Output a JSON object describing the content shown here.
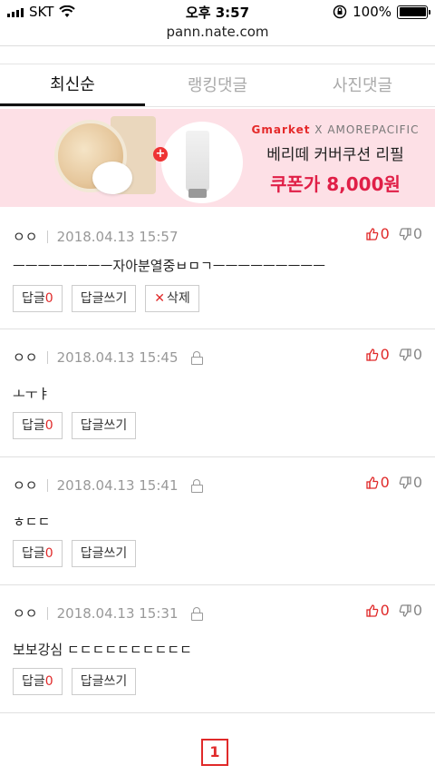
{
  "status_bar": {
    "carrier": "SKT",
    "time": "오후 3:57",
    "battery": "100%"
  },
  "browser": {
    "url": "pann.nate.com"
  },
  "tabs": [
    {
      "label": "최신순",
      "active": true
    },
    {
      "label": "랭킹댓글",
      "active": false
    },
    {
      "label": "사진댓글",
      "active": false
    }
  ],
  "banner": {
    "brand_gmarket": "Gmarket",
    "brand_rest": "X AMOREPACIFIC",
    "line1": "베리떼 커버쿠션 리필",
    "line2": "쿠폰가 8,000원"
  },
  "comments": [
    {
      "author": "ㅇㅇ",
      "date": "2018.04.13 15:57",
      "locked": false,
      "up": "0",
      "down": "0",
      "text": "ㅡㅡㅡㅡㅡㅡㅡㅡ자아분열중ㅂㅁㄱㅡㅡㅡㅡㅡㅡㅡㅡㅡ",
      "reply_label": "답글",
      "reply_count": "0",
      "write_label": "답글쓰기",
      "delete_label": "삭제"
    },
    {
      "author": "ㅇㅇ",
      "date": "2018.04.13 15:45",
      "locked": true,
      "up": "0",
      "down": "0",
      "text": "ㅗㅜㅑ",
      "reply_label": "답글",
      "reply_count": "0",
      "write_label": "답글쓰기"
    },
    {
      "author": "ㅇㅇ",
      "date": "2018.04.13 15:41",
      "locked": true,
      "up": "0",
      "down": "0",
      "text": "ㅎㄷㄷ",
      "reply_label": "답글",
      "reply_count": "0",
      "write_label": "답글쓰기"
    },
    {
      "author": "ㅇㅇ",
      "date": "2018.04.13 15:31",
      "locked": true,
      "up": "0",
      "down": "0",
      "text": "보보강심 ㄷㄷㄷㄷㄷㄷㄷㄷㄷㄷ",
      "reply_label": "답글",
      "reply_count": "0",
      "write_label": "답글쓰기"
    }
  ],
  "pagination": {
    "current": "1"
  },
  "colors": {
    "accent": "#e02a2a",
    "banner_bg": "#fde0e6",
    "price": "#e01f47"
  }
}
